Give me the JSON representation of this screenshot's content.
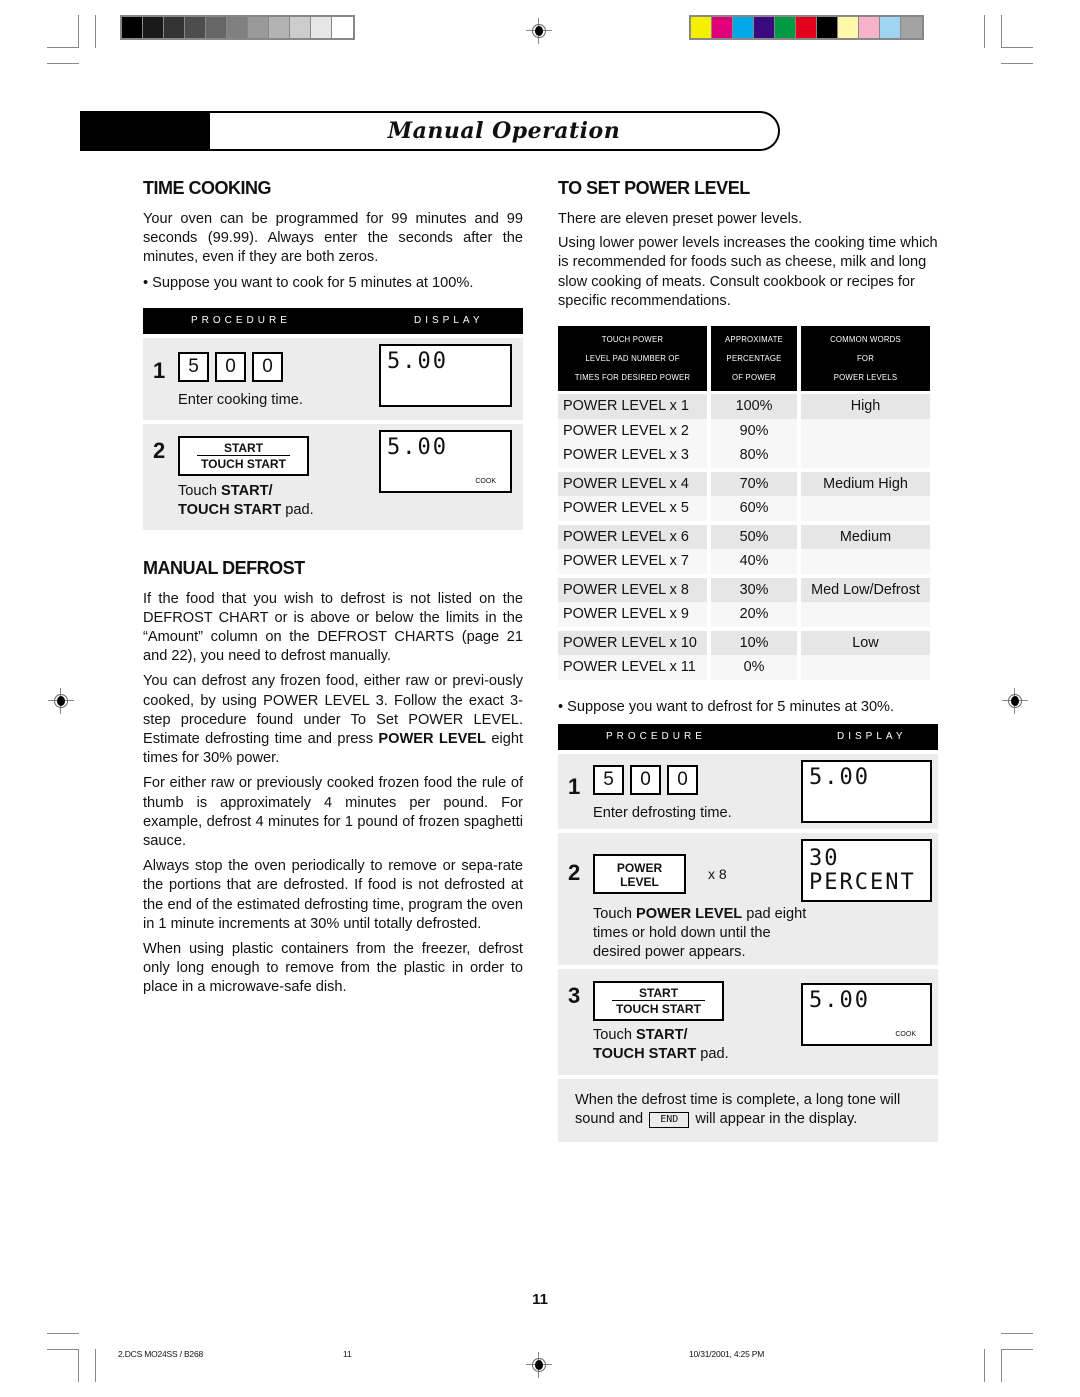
{
  "print_marks": {
    "grayscale_swatches": [
      "#000000",
      "#1a1a1a",
      "#333333",
      "#4d4d4d",
      "#666666",
      "#808080",
      "#999999",
      "#b3b3b3",
      "#cccccc",
      "#e6e6e6",
      "#ffffff"
    ],
    "color_swatches": [
      "#f5f000",
      "#e0007a",
      "#00a8e8",
      "#3b0a80",
      "#009a44",
      "#e3001b",
      "#000000",
      "#fff8a8",
      "#f7b1c9",
      "#9fd4f2",
      "#a3a3a3"
    ]
  },
  "header": {
    "title": "Manual Operation"
  },
  "time_cooking": {
    "heading": "TIME COOKING",
    "paragraph": "Your oven can be programmed for 99 minutes and 99 seconds (99.99). Always enter the seconds after the minutes, even if they are both zeros.",
    "bullet": "•  Suppose you want to cook for 5 minutes at 100%.",
    "procedure": {
      "header_procedure": "PROCEDURE",
      "header_display": "DISPLAY",
      "step1": {
        "number": "1",
        "digits": [
          "5",
          "0",
          "0"
        ],
        "caption": "Enter cooking time.",
        "display": "5.00"
      },
      "step2": {
        "number": "2",
        "key_top": "START",
        "key_bottom": "TOUCH START",
        "caption_pre": "Touch ",
        "caption_bold1": "START/",
        "caption_bold2": "TOUCH START",
        "caption_post": " pad.",
        "display": "5.00",
        "indicator": "COOK"
      }
    }
  },
  "manual_defrost": {
    "heading": "MANUAL DEFROST",
    "p1": "If the food that you wish to defrost is not listed on the DEFROST CHART or is above or  below the limits in the “Amount” column on the DEFROST CHARTS (page 21 and 22), you need to defrost manually.",
    "p2_pre": "You can defrost any frozen food, either raw or previ-ously cooked, by using POWER LEVEL 3. Follow the exact 3-step procedure found under To Set POWER LEVEL. Estimate defrosting time and press ",
    "p2_bold": "POWER LEVEL",
    "p2_post": " eight times for 30% power.",
    "p3": "For either raw or previously cooked frozen food the rule of thumb is approximately 4 minutes per pound. For example, defrost 4 minutes for 1 pound of frozen spaghetti sauce.",
    "p4": "Always stop the oven periodically to remove or sepa-rate the portions that are defrosted. If food is not defrosted at the end of the estimated defrosting time, program the oven in 1 minute increments at 30% until totally defrosted.",
    "p5": "When using plastic containers from the freezer, defrost only long enough to remove from the plastic in order to place in a microwave-safe dish."
  },
  "set_power_level": {
    "heading": "TO SET POWER LEVEL",
    "p1": "There are eleven preset power levels.",
    "p2": "Using lower power levels increases the cooking time which is recommended for foods such as cheese, milk and long slow cooking of meats. Consult cookbook or recipes for specific recommendations.",
    "table": {
      "headers": [
        [
          "TOUCH POWER",
          "LEVEL PAD NUMBER OF",
          "TIMES FOR DESIRED POWER"
        ],
        [
          "APPROXIMATE",
          "PERCENTAGE",
          "OF POWER"
        ],
        [
          "COMMON WORDS",
          "FOR",
          "POWER LEVELS"
        ]
      ],
      "rows": [
        {
          "pad": "POWER LEVEL x 1",
          "percent": "100%",
          "word": "High"
        },
        {
          "pad": "POWER LEVEL x 2",
          "percent": "90%",
          "word": ""
        },
        {
          "pad": "POWER LEVEL x 3",
          "percent": "80%",
          "word": ""
        },
        {
          "pad": "POWER LEVEL x 4",
          "percent": "70%",
          "word": "Medium High"
        },
        {
          "pad": "POWER LEVEL x 5",
          "percent": "60%",
          "word": ""
        },
        {
          "pad": "POWER LEVEL x 6",
          "percent": "50%",
          "word": "Medium"
        },
        {
          "pad": "POWER LEVEL x 7",
          "percent": "40%",
          "word": ""
        },
        {
          "pad": "POWER LEVEL x 8",
          "percent": "30%",
          "word": "Med Low/Defrost"
        },
        {
          "pad": "POWER LEVEL x 9",
          "percent": "20%",
          "word": ""
        },
        {
          "pad": "POWER LEVEL x 10",
          "percent": "10%",
          "word": "Low"
        },
        {
          "pad": "POWER LEVEL x 11",
          "percent": "0%",
          "word": ""
        }
      ]
    },
    "bullet": "•  Suppose you want to defrost for 5 minutes at 30%.",
    "procedure": {
      "header_procedure": "PROCEDURE",
      "header_display": "DISPLAY",
      "step1": {
        "number": "1",
        "digits": [
          "5",
          "0",
          "0"
        ],
        "caption": "Enter defrosting time.",
        "display": "5.00"
      },
      "step2": {
        "number": "2",
        "key_line1": "POWER",
        "key_line2": "LEVEL",
        "times": "x 8",
        "caption_pre": "Touch ",
        "caption_bold": "POWER LEVEL",
        "caption_post": " pad eight times or hold down until the desired power appears.",
        "display_line1": "30",
        "display_line2": "PERCENT"
      },
      "step3": {
        "number": "3",
        "key_top": "START",
        "key_bottom": "TOUCH START",
        "caption_pre": "Touch ",
        "caption_bold1": "START/",
        "caption_bold2": "TOUCH START",
        "caption_post": " pad.",
        "display": "5.00",
        "indicator": "COOK"
      }
    },
    "end_note": {
      "pre": "When the defrost time is complete, a long tone will sound and ",
      "display_word": "END",
      "post": " will appear in the display."
    }
  },
  "page_number": "11",
  "footer": {
    "job": "2.DCS MO24SS / B268",
    "page": "11",
    "timestamp": "10/31/2001, 4:25 PM"
  }
}
